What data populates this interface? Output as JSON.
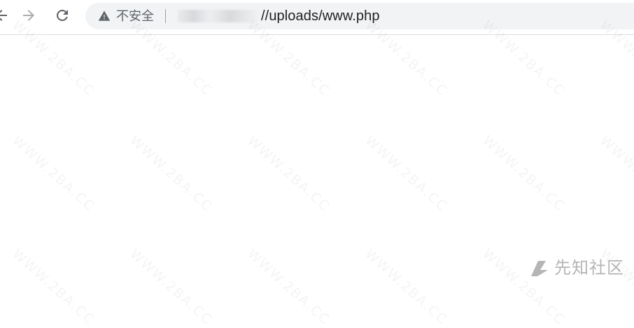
{
  "browser": {
    "security_label": "不安全",
    "url_visible_text": "//uploads/www.php",
    "icons": {
      "back": "arrow-left-icon",
      "forward": "arrow-right-icon",
      "reload": "reload-icon",
      "security": "warning-triangle-icon"
    }
  },
  "watermark": {
    "text": "WWW.2BA.CC"
  },
  "brand": {
    "text": "先知社区",
    "icon": "xianzhi-logo-icon"
  },
  "colors": {
    "toolbar_background": "#ffffff",
    "omnibox_background": "#f1f3f4",
    "text_primary": "#202124",
    "text_secondary": "#5f6368"
  }
}
